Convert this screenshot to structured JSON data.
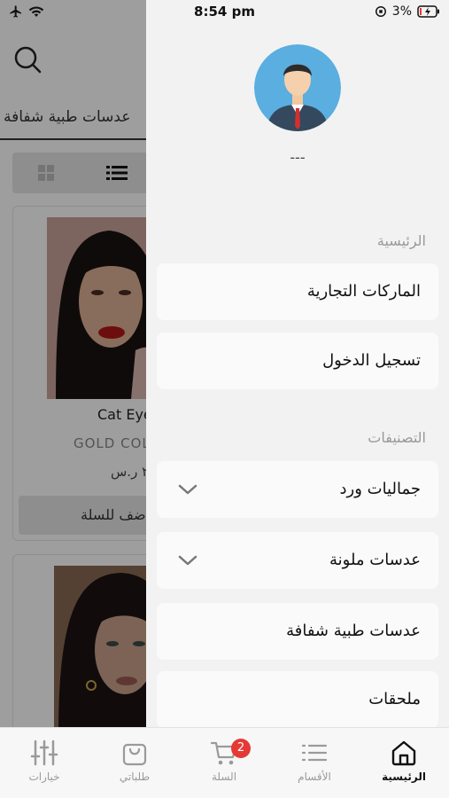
{
  "status": {
    "time": "8:54 pm",
    "battery": "3%"
  },
  "background": {
    "category_title": "عدسات طبية شفافة",
    "product": {
      "name": "Cat Eye",
      "brand": "GOLD COL",
      "price": "٢ ر.س",
      "add_to_cart": "ضف للسلة"
    }
  },
  "drawer": {
    "username": "---",
    "section_main": "الرئيسية",
    "main_items": [
      {
        "label": "الماركات التجارية"
      },
      {
        "label": "تسجيل الدخول"
      }
    ],
    "section_categories": "التصنيفات",
    "category_items": [
      {
        "label": "جماليات ورد",
        "expandable": true
      },
      {
        "label": "عدسات ملونة",
        "expandable": true
      },
      {
        "label": "عدسات طبية شفافة",
        "expandable": false
      },
      {
        "label": "ملحقات",
        "expandable": false
      }
    ]
  },
  "bottom_nav": {
    "items": [
      {
        "label": "خيارات",
        "icon": "sliders-icon"
      },
      {
        "label": "طلباتي",
        "icon": "bag-icon"
      },
      {
        "label": "السلة",
        "icon": "cart-icon",
        "badge": "2"
      },
      {
        "label": "الأقسام",
        "icon": "list-icon"
      },
      {
        "label": "الرئيسية",
        "icon": "home-icon",
        "active": true
      }
    ]
  }
}
